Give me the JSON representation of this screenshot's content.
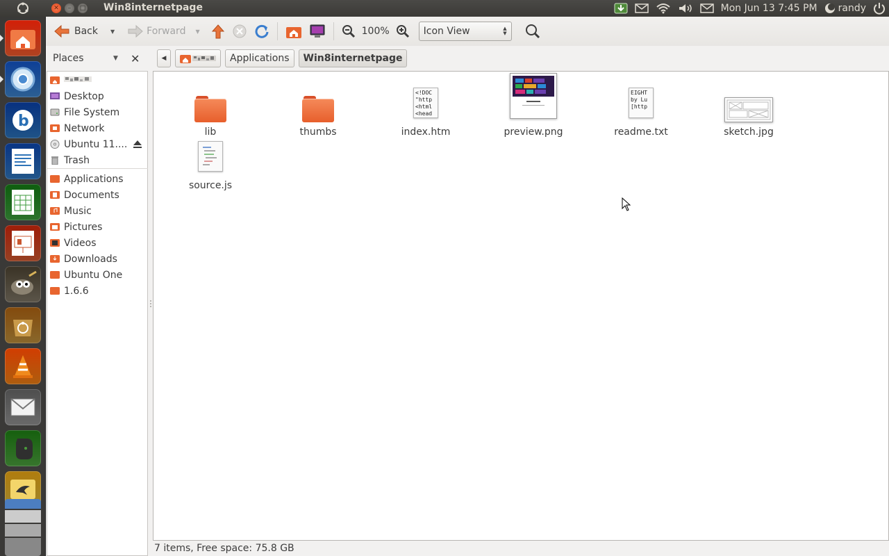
{
  "top_panel": {
    "window_title": "Win8internetpage",
    "datetime": "Mon Jun 13  7:45 PM",
    "user": "randy"
  },
  "launcher": {
    "items": [
      {
        "name": "home-folder-launcher",
        "color": "#e8592c",
        "running": true
      },
      {
        "name": "chromium-launcher",
        "color": "#3b7fc4",
        "running": true
      },
      {
        "name": "bible-app-launcher",
        "color": "#2a6fb4",
        "running": false
      },
      {
        "name": "writer-launcher",
        "color": "#2f74b8",
        "running": false
      },
      {
        "name": "calc-launcher",
        "color": "#3c9a3c",
        "running": false
      },
      {
        "name": "impress-launcher",
        "color": "#c9562f",
        "running": false
      },
      {
        "name": "gimp-launcher",
        "color": "#7a7262",
        "running": false
      },
      {
        "name": "software-center-launcher",
        "color": "#b78a3a",
        "running": false
      },
      {
        "name": "vlc-launcher",
        "color": "#e77d14",
        "running": false
      },
      {
        "name": "mail-launcher",
        "color": "#8d8d8d",
        "running": false
      },
      {
        "name": "evernote-launcher",
        "color": "#4a9c3c",
        "running": false
      },
      {
        "name": "gwibber-launcher",
        "color": "#d4b23a",
        "running": false
      }
    ]
  },
  "toolbar": {
    "back_label": "Back",
    "forward_label": "Forward",
    "zoom_level": "100%",
    "view_mode": "Icon View"
  },
  "sidebar": {
    "header": "Places",
    "items_top": [
      {
        "label": "",
        "icon": "home-folder-icon"
      },
      {
        "label": "Desktop",
        "icon": "desktop-icon"
      },
      {
        "label": "File System",
        "icon": "filesystem-icon"
      },
      {
        "label": "Network",
        "icon": "network-icon"
      },
      {
        "label": "Ubuntu 11....",
        "icon": "disc-icon"
      },
      {
        "label": "Trash",
        "icon": "trash-icon"
      }
    ],
    "items_bookmarks": [
      {
        "label": "Applications",
        "icon": "folder-icon"
      },
      {
        "label": "Documents",
        "icon": "documents-folder-icon"
      },
      {
        "label": "Music",
        "icon": "music-folder-icon"
      },
      {
        "label": "Pictures",
        "icon": "pictures-folder-icon"
      },
      {
        "label": "Videos",
        "icon": "videos-folder-icon"
      },
      {
        "label": "Downloads",
        "icon": "downloads-folder-icon"
      },
      {
        "label": "Ubuntu One",
        "icon": "folder-icon"
      },
      {
        "label": "1.6.6",
        "icon": "folder-icon"
      }
    ]
  },
  "pathbar": {
    "crumbs": [
      "",
      "Applications",
      "Win8internetpage"
    ]
  },
  "files": [
    {
      "name": "lib",
      "type": "folder"
    },
    {
      "name": "thumbs",
      "type": "folder"
    },
    {
      "name": "index.htm",
      "type": "text",
      "preview": "<!DOC\n\"http\n<html\n<head"
    },
    {
      "name": "preview.png",
      "type": "image"
    },
    {
      "name": "readme.txt",
      "type": "text",
      "preview": "EIGHT\nby Lu\n[http"
    },
    {
      "name": "sketch.jpg",
      "type": "image"
    },
    {
      "name": "source.js",
      "type": "script"
    }
  ],
  "statusbar": {
    "text": "7 items, Free space: 75.8 GB"
  }
}
